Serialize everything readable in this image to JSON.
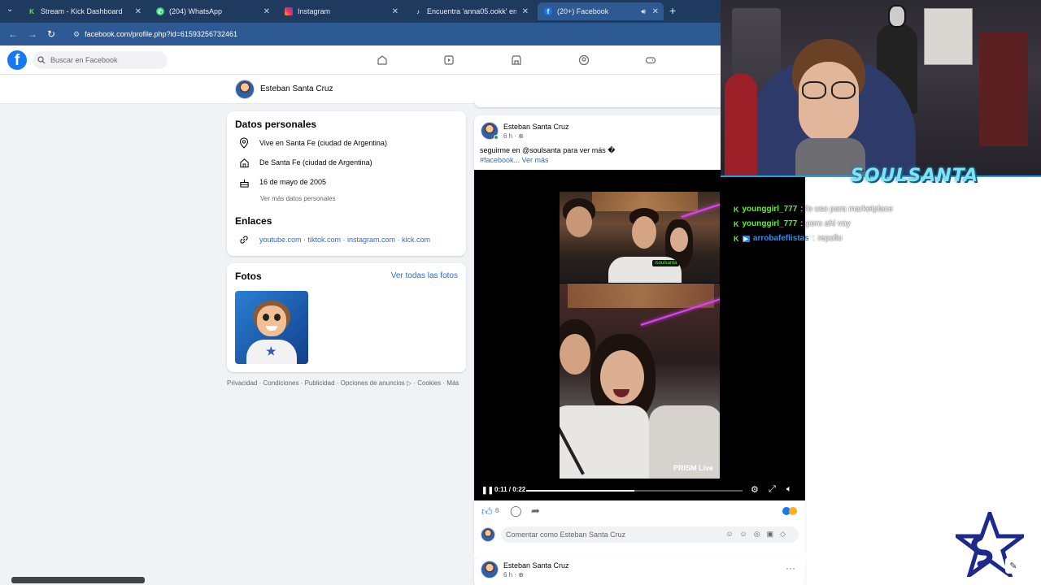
{
  "browser": {
    "tabs": [
      {
        "title": "Stream - Kick Dashboard",
        "icon": "kick-icon",
        "color": "#53fc18"
      },
      {
        "title": "(204) WhatsApp",
        "icon": "whatsapp-icon",
        "color": "#25d366"
      },
      {
        "title": "Instagram",
        "icon": "instagram-icon",
        "color": "#e1306c"
      },
      {
        "title": "Encuentra 'anna05.ookk' en Ti...",
        "icon": "tiktok-icon",
        "color": "#ffffff"
      },
      {
        "title": "(20+) Facebook",
        "icon": "facebook-icon",
        "color": "#1877f2"
      }
    ],
    "url": "facebook.com/profile.php?id=61593256732461"
  },
  "fb": {
    "search_placeholder": "Buscar en Facebook",
    "profile_name": "Esteban Santa Cruz",
    "personal": {
      "title": "Datos personales",
      "lives": "Vive en Santa Fe (ciudad de Argentina)",
      "from": "De Santa Fe (ciudad de Argentina)",
      "birthday": "16 de mayo de 2005",
      "more": "Ver más datos personales"
    },
    "links": {
      "title": "Enlaces",
      "text": "youtube.com · tiktok.com · instagram.com · kick.com"
    },
    "photos": {
      "title": "Fotos",
      "see_all": "Ver todas las fotos"
    },
    "footer": "Privacidad · Condiciones · Publicidad · Opciones de anuncios ▷ · Cookies · Más",
    "post": {
      "author": "Esteban Santa Cruz",
      "time": "6 h · ",
      "text": "seguirme en @soulsanta para ver más �",
      "hashtag": "#facebook",
      "more": "... Ver más",
      "video": {
        "time": "0:11 / 0:22",
        "progress": 0.5,
        "watermark": "PRISM Live",
        "kick_tag": "/soulsanta"
      },
      "likes": "6",
      "comment_placeholder": "Comentar como Esteban Santa Cruz"
    },
    "post2": {
      "author": "Esteban Santa Cruz",
      "time": "6 h · "
    }
  },
  "stream": {
    "logo": "SOULSANTA",
    "chat": [
      {
        "user": "younggirl_777",
        "sep": " : ",
        "msg": "lo uso para marketplace"
      },
      {
        "user": "younggirl_777",
        "sep": " : ",
        "msg": "pero ahi voy"
      },
      {
        "user": "arrobafeflistas",
        "sep": " : ",
        "msg": "repollo"
      }
    ]
  }
}
